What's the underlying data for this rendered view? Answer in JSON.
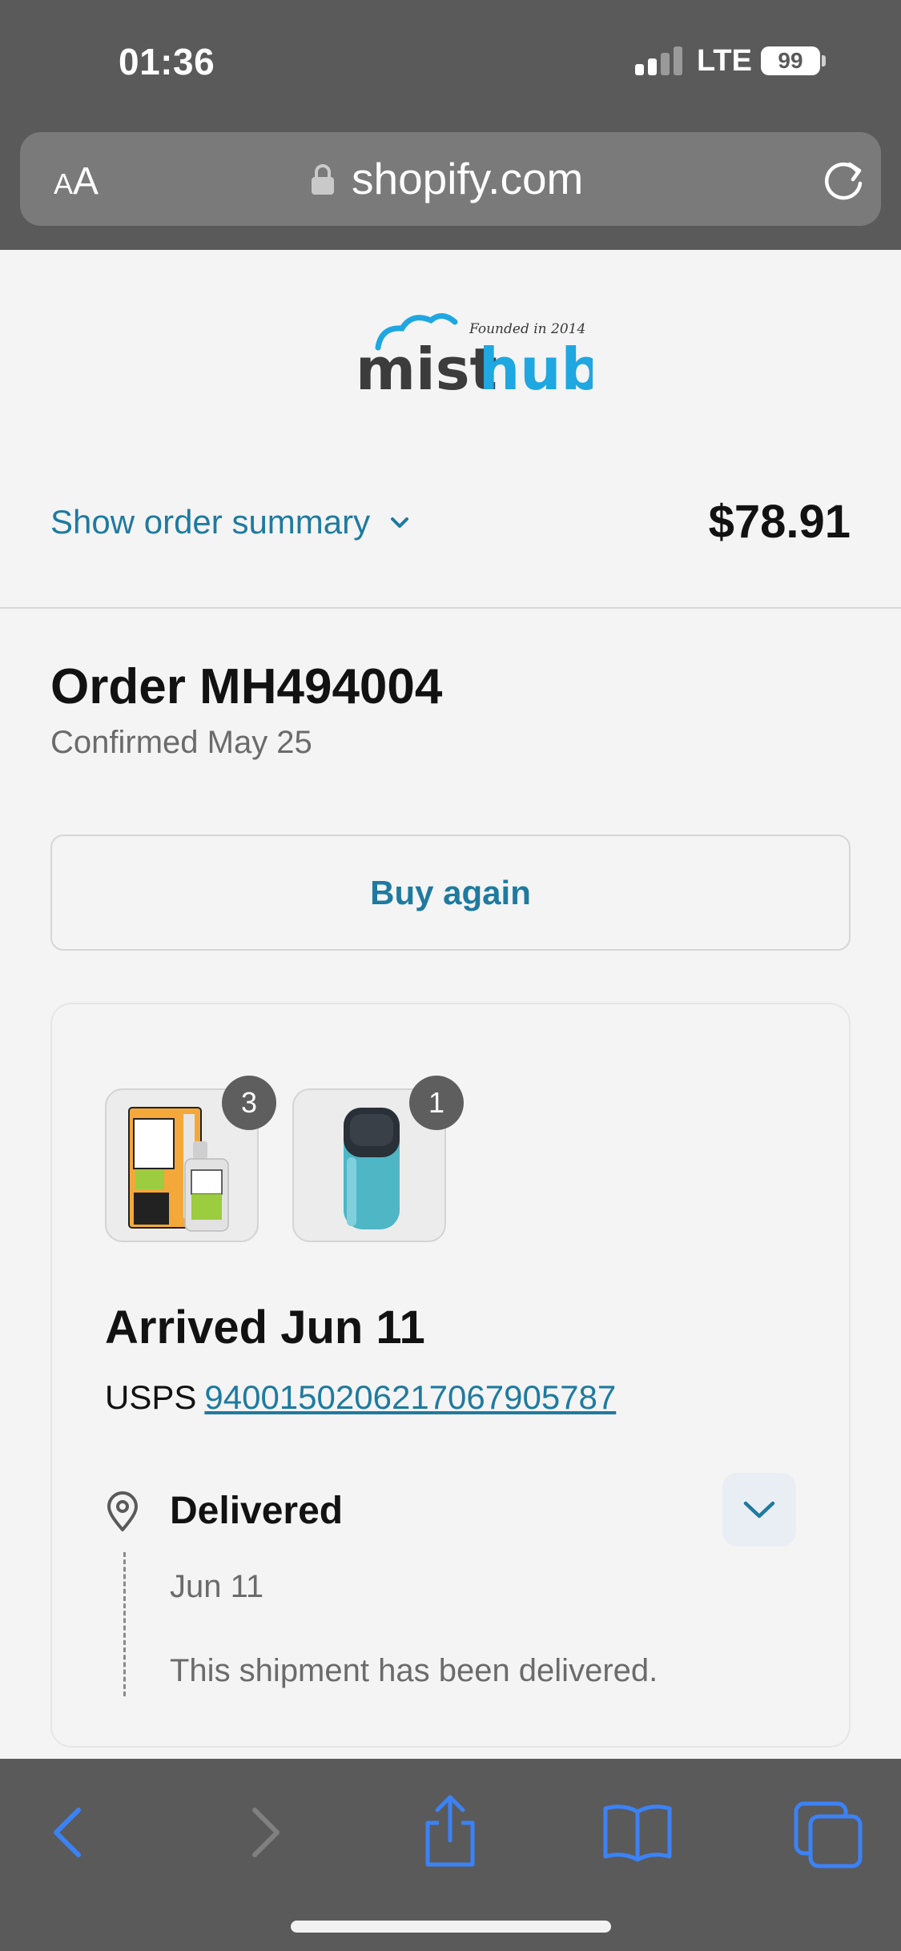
{
  "status_bar": {
    "time": "01:36",
    "network": "LTE",
    "battery": "99"
  },
  "browser": {
    "aa_small": "A",
    "aa_big": "A",
    "url": "shopify.com"
  },
  "brand": {
    "logo_text_left": "mist",
    "logo_text_right": "hub",
    "tagline": "Founded in 2014",
    "accent": "#1ea7e1"
  },
  "summary": {
    "toggle_label": "Show order summary",
    "total": "$78.91"
  },
  "order": {
    "title": "Order MH494004",
    "confirmed": "Confirmed May 25",
    "buy_again_label": "Buy again"
  },
  "shipment": {
    "items": [
      {
        "name": "juice-head-salts-product",
        "quantity": "3"
      },
      {
        "name": "pod-device-product",
        "quantity": "1"
      }
    ],
    "status_title": "Arrived Jun 11",
    "carrier": "USPS",
    "tracking_number": "9400150206217067905787",
    "event_title": "Delivered",
    "event_date": "Jun 11",
    "event_message": "This shipment has been delivered."
  },
  "colors": {
    "link": "#1f7aa0",
    "chrome": "#5a5a5a",
    "toolbar_icon": "#3b82f6"
  }
}
